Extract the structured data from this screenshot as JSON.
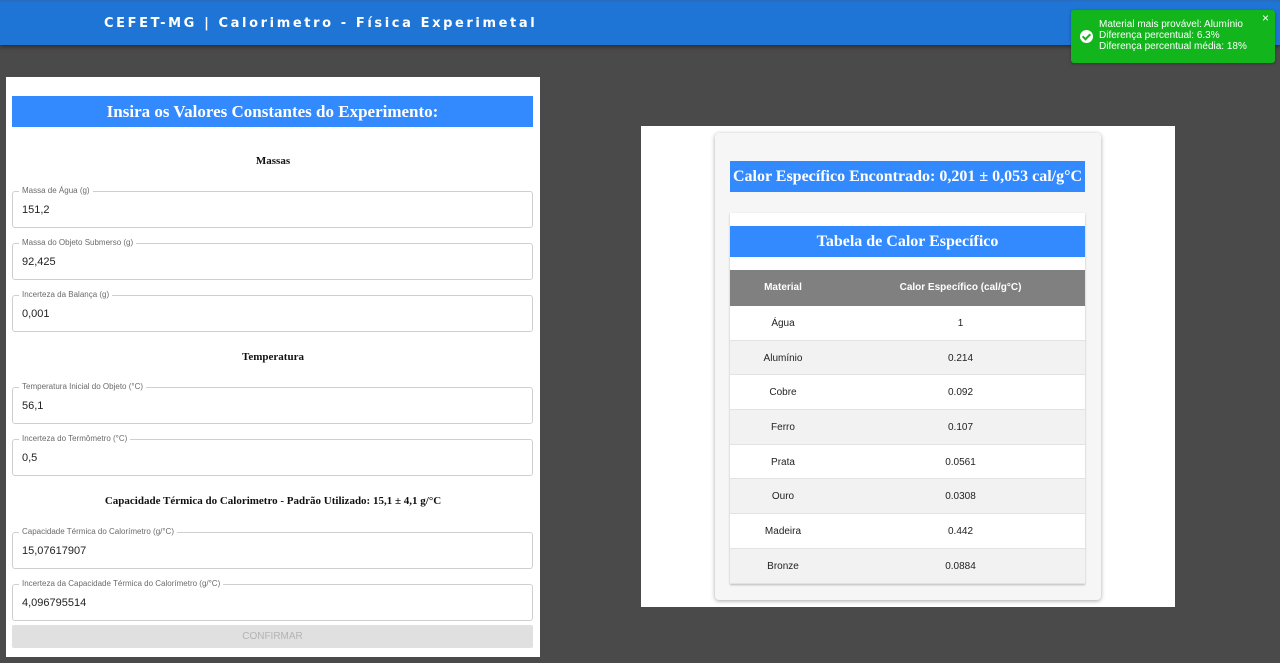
{
  "header": {
    "title": "CEFET-MG | Calorimetro - Física Experimetal"
  },
  "toast": {
    "line1": "Material mais provável: Alumínio",
    "line2": "Diferença percentual: 6.3%",
    "line3": "Diferença percentual média: 18%",
    "close": "×",
    "icon": "check-circle-icon",
    "color": "#12b51c"
  },
  "form": {
    "title": "Insira os Valores Constantes do Experimento:",
    "sections": {
      "massas": "Massas",
      "temperatura": "Temperatura",
      "capacidade": "Capacidade Térmica do Calorimetro - Padrão Utilizado: 15,1 ± 4,1 g/°C"
    },
    "fields": [
      {
        "label": "Massa de Água (g)",
        "value": "151,2"
      },
      {
        "label": "Massa do Objeto Submerso (g)",
        "value": "92,425"
      },
      {
        "label": "Incerteza da Balança (g)",
        "value": "0,001"
      },
      {
        "label": "Temperatura Inicial do Objeto (°C)",
        "value": "56,1"
      },
      {
        "label": "Incerteza do Termômetro (°C)",
        "value": "0,5"
      },
      {
        "label": "Capacidade Térmica do Calorímetro (g/°C)",
        "value": "15,07617907"
      },
      {
        "label": "Incerteza da Capacidade Térmica do Calorímetro (g/°C)",
        "value": "4,096795514"
      }
    ],
    "confirm_label": "CONFIRMAR"
  },
  "results": {
    "found": "Calor Específico Encontrado: 0,201 ± 0,053 cal/g°C",
    "table_title": "Tabela de Calor Específico",
    "columns": [
      "Material",
      "Calor Específico (cal/g°C)"
    ],
    "rows": [
      [
        "Água",
        "1"
      ],
      [
        "Alumínio",
        "0.214"
      ],
      [
        "Cobre",
        "0.092"
      ],
      [
        "Ferro",
        "0.107"
      ],
      [
        "Prata",
        "0.0561"
      ],
      [
        "Ouro",
        "0.0308"
      ],
      [
        "Madeira",
        "0.442"
      ],
      [
        "Bronze",
        "0.0884"
      ]
    ]
  },
  "colors": {
    "accent": "#338aff",
    "topbar": "#1f75d6",
    "background": "#4b4a4a",
    "table_header": "#808080"
  }
}
